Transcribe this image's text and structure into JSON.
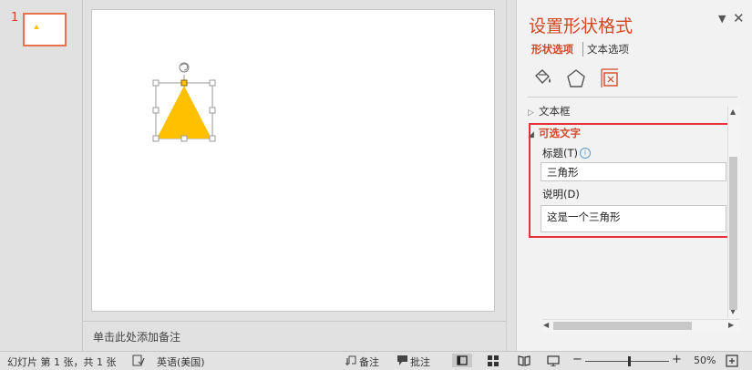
{
  "thumbnails": {
    "number": "1"
  },
  "notes": {
    "placeholder": "单击此处添加备注"
  },
  "pane": {
    "title": "设置形状格式",
    "menu_glyph": "▼",
    "close_glyph": "✕",
    "tabs": [
      "形状选项",
      "文本选项"
    ],
    "icons": [
      "fill-line-icon",
      "effects-icon",
      "size-properties-icon"
    ],
    "sections": {
      "textbox": "文本框",
      "alt_text": "可选文字"
    },
    "fields": {
      "title_label": "标题(T)",
      "title_value": "三角形",
      "desc_label": "说明(D)",
      "desc_value": "这是一个三角形"
    },
    "info_glyph": "i"
  },
  "status": {
    "slide_info": "幻灯片 第 1 张，共 1 张",
    "language": "英语(美国)",
    "notes_label": "备注",
    "comments_label": "批注",
    "zoom": "50%"
  },
  "colors": {
    "accent": "#d24726",
    "shape_fill": "#ffc000",
    "highlight": "#e8303a"
  }
}
